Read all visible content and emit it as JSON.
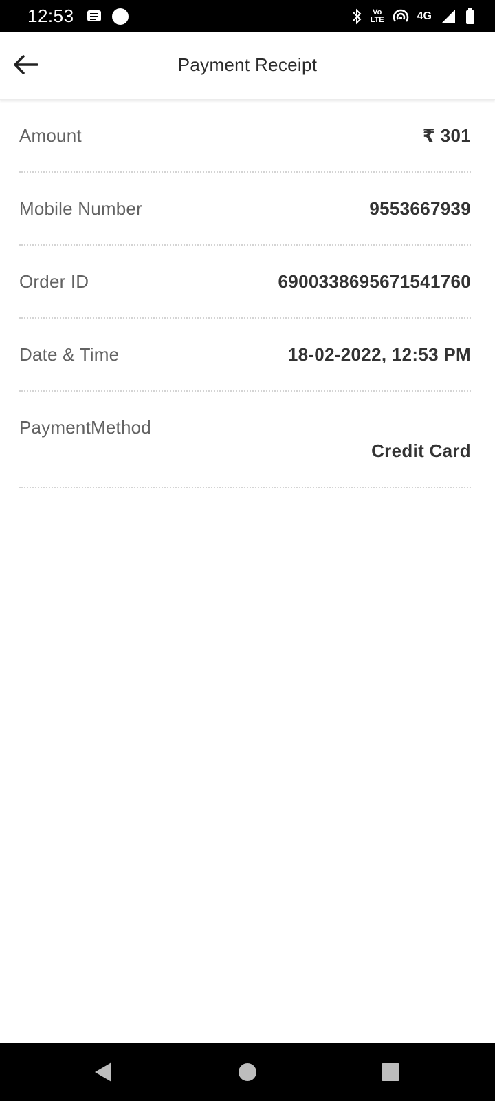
{
  "status_bar": {
    "time": "12:53",
    "lte_line1": "Vo",
    "lte_line2": "LTE",
    "network": "4G"
  },
  "app_bar": {
    "title": "Payment Receipt",
    "back_icon": "arrow-left-icon"
  },
  "receipt": {
    "rows": [
      {
        "label": "Amount",
        "value": "₹ 301"
      },
      {
        "label": "Mobile Number",
        "value": "9553667939"
      },
      {
        "label": "Order ID",
        "value": "6900338695671541760"
      },
      {
        "label": "Date & Time",
        "value": "18-02-2022, 12:53 PM"
      },
      {
        "label": "PaymentMethod",
        "value": "Credit Card"
      }
    ]
  },
  "nav_bar": {
    "back_icon": "triangle-back-icon",
    "home_icon": "circle-home-icon",
    "recents_icon": "square-recents-icon"
  },
  "colors": {
    "status_bar_bg": "#000000",
    "label": "#626262",
    "value": "#333333",
    "divider": "#d4d4d4"
  }
}
